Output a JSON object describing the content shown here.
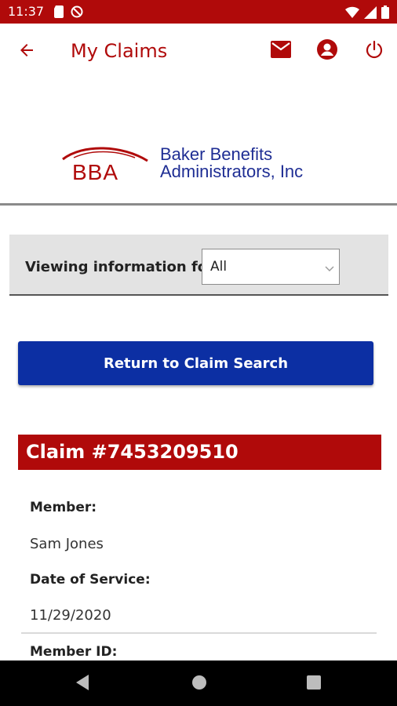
{
  "status_bar": {
    "time": "11:37",
    "background": "#b00a0a",
    "left_icons": [
      "sd-card-icon",
      "no-disturb-icon"
    ],
    "right_icons": [
      "wifi-icon",
      "signal-icon",
      "battery-icon"
    ]
  },
  "app_bar": {
    "title": "My Claims",
    "back_icon": "arrow-left-icon",
    "actions": [
      "mail-icon",
      "account-icon",
      "power-icon"
    ],
    "accent": "#b00a0a"
  },
  "logo": {
    "mark_text": "BBA",
    "company_line1": "Baker Benefits",
    "company_line2": "Administrators, Inc",
    "text_color": "#1f2e94"
  },
  "viewing": {
    "label": "Viewing information for:",
    "selected": "All"
  },
  "return_button": {
    "label": "Return to Claim Search",
    "color": "#0c2fa3"
  },
  "claim": {
    "title": "Claim #7453209510",
    "fields": [
      {
        "label": "Member:",
        "value": "Sam Jones"
      },
      {
        "label": "Date of Service:",
        "value": "11/29/2020"
      },
      {
        "label": "Member ID:",
        "value": ""
      }
    ]
  },
  "nav_bar": {
    "buttons": [
      "back-triangle-icon",
      "home-circle-icon",
      "recents-square-icon"
    ]
  }
}
